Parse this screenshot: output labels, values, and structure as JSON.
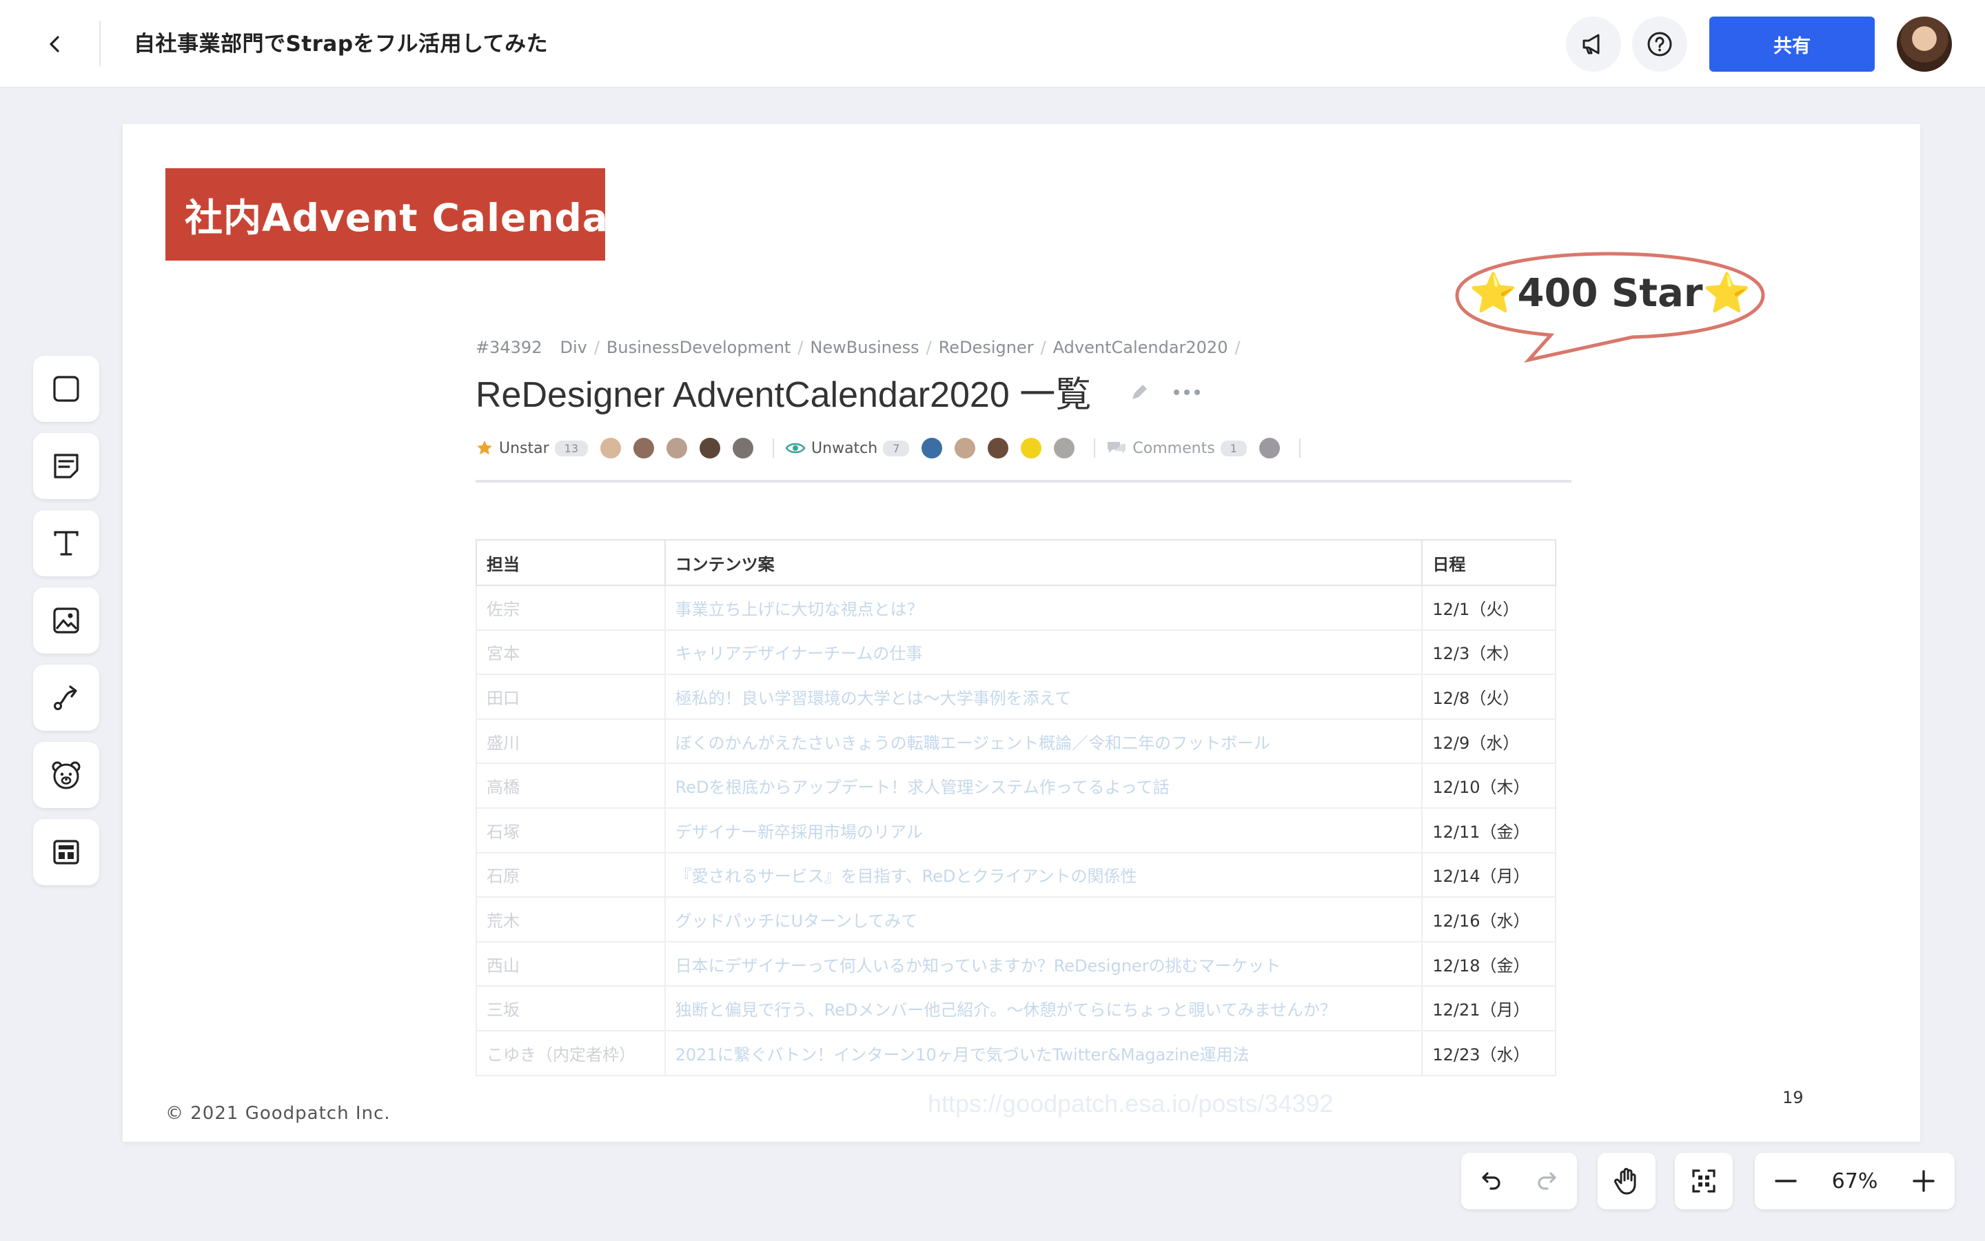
{
  "header": {
    "title": "自社事業部門でStrapをフル活用してみた",
    "share_label": "共有"
  },
  "slide": {
    "banner": "社内Advent Calendar",
    "speech": {
      "star_left": "⭐",
      "text": "400 Star",
      "star_right": "⭐"
    },
    "copyright": "© 2021 Goodpatch Inc.",
    "page_number": "19",
    "ghost_url": "https://goodpatch.esa.io/posts/34392"
  },
  "esa": {
    "breadcrumb": [
      "#34392",
      "Div",
      "BusinessDevelopment",
      "NewBusiness",
      "ReDesigner",
      "AdventCalendar2020"
    ],
    "title": "ReDesigner AdventCalendar2020 一覧",
    "unstar_label": "Unstar",
    "star_count": "13",
    "unwatch_label": "Unwatch",
    "watch_count": "7",
    "comments_label": "Comments",
    "comments_count": "1",
    "table": {
      "headers": [
        "担当",
        "コンテンツ案",
        "日程"
      ],
      "rows": [
        [
          "佐宗",
          "事業立ち上げに大切な視点とは？",
          "12/1（火）"
        ],
        [
          "宮本",
          "キャリアデザイナーチームの仕事",
          "12/3（木）"
        ],
        [
          "田口",
          "極私的！良い学習環境の大学とは〜大学事例を添えて",
          "12/8（火）"
        ],
        [
          "盛川",
          "ぼくのかんがえたさいきょうの転職エージェント概論／令和二年のフットボール",
          "12/9（水）"
        ],
        [
          "高橋",
          "ReDを根底からアップデート！求人管理システム作ってるよって話",
          "12/10（木）"
        ],
        [
          "石塚",
          "デザイナー新卒採用市場のリアル",
          "12/11（金）"
        ],
        [
          "石原",
          "『愛されるサービス』を目指す、ReDとクライアントの関係性",
          "12/14（月）"
        ],
        [
          "荒木",
          "グッドパッチにUターンしてみて",
          "12/16（水）"
        ],
        [
          "西山",
          "日本にデザイナーって何人いるか知っていますか？ReDesignerの挑むマーケット",
          "12/18（金）"
        ],
        [
          "三坂",
          "独断と偏見で行う、ReDメンバー他己紹介。〜休憩がてらにちょっと覗いてみませんか？",
          "12/21（月）"
        ],
        [
          "こゆき（内定者枠）",
          "2021に繋ぐバトン！インターン10ヶ月で気づいたTwitter&Magazine運用法",
          "12/23（水）"
        ]
      ]
    }
  },
  "toolbar": [
    "square-tool",
    "sticky-note-tool",
    "text-tool",
    "image-tool",
    "connector-tool",
    "bear-tool",
    "template-tool"
  ],
  "zoom": {
    "value": "67%"
  },
  "colors": {
    "accent": "#2d62ee",
    "banner": "#c84535",
    "bubble_stroke": "#d9776b"
  }
}
